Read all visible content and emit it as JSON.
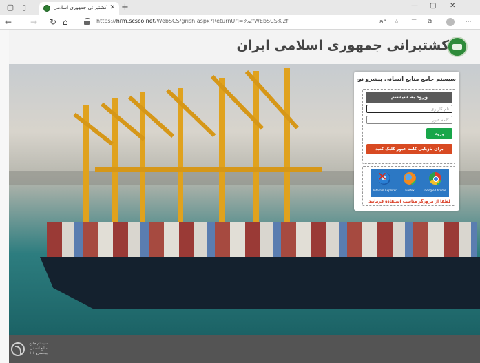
{
  "browser": {
    "tab_title": "کشتیرانی جمهوری اسلامی ایران",
    "tab_close": "✕",
    "new_tab": "+",
    "url_prefix": "https://",
    "url_host": "hrm.scsco.net",
    "url_path": "/WebSCS/grish.aspx?ReturnUrl=%2fWEbSCS%2f",
    "icons": {
      "tab_actions": "tab-actions-icon",
      "tabs": "tabs-icon",
      "back": "back-arrow-icon",
      "forward": "forward-arrow-icon",
      "refresh": "refresh-icon",
      "home": "home-icon",
      "lock": "lock-icon",
      "read_aloud": "read-aloud-icon",
      "favorite": "star-icon",
      "favorites": "favorites-list-icon",
      "collections": "collections-icon",
      "profile": "profile-icon",
      "more": "more-icon"
    }
  },
  "header": {
    "title": "کشتیرانی جمهوری اسلامی ایران"
  },
  "panel": {
    "title": "سیستم جامع منابع انسانی پیشرو نوین",
    "login_heading": "ورود به سیستم",
    "username_placeholder": "نام کاربری",
    "password_placeholder": "کلمه عبور",
    "enter_label": "ورود",
    "recover_label": "برای بازیابی کلمه عبور کلیک کنید",
    "browsers": [
      {
        "name": "Internet Explorer",
        "status": "unsupported"
      },
      {
        "name": "Firefox",
        "status": "supported"
      },
      {
        "name": "Google Chrome",
        "status": "supported"
      }
    ],
    "browser_note": "لطفا از مرورگر مناسب استفاده فرمایید"
  },
  "footer": {
    "line1": "سیستم جامع",
    "line2": "منابع انسانی",
    "line3": "پیـــشرو ++"
  },
  "colors": {
    "enter_button": "#18a64a",
    "recover_button": "#d84a22",
    "login_heading": "#5b5b5b",
    "footer": "#545454",
    "logo": "#2e8b3a"
  }
}
